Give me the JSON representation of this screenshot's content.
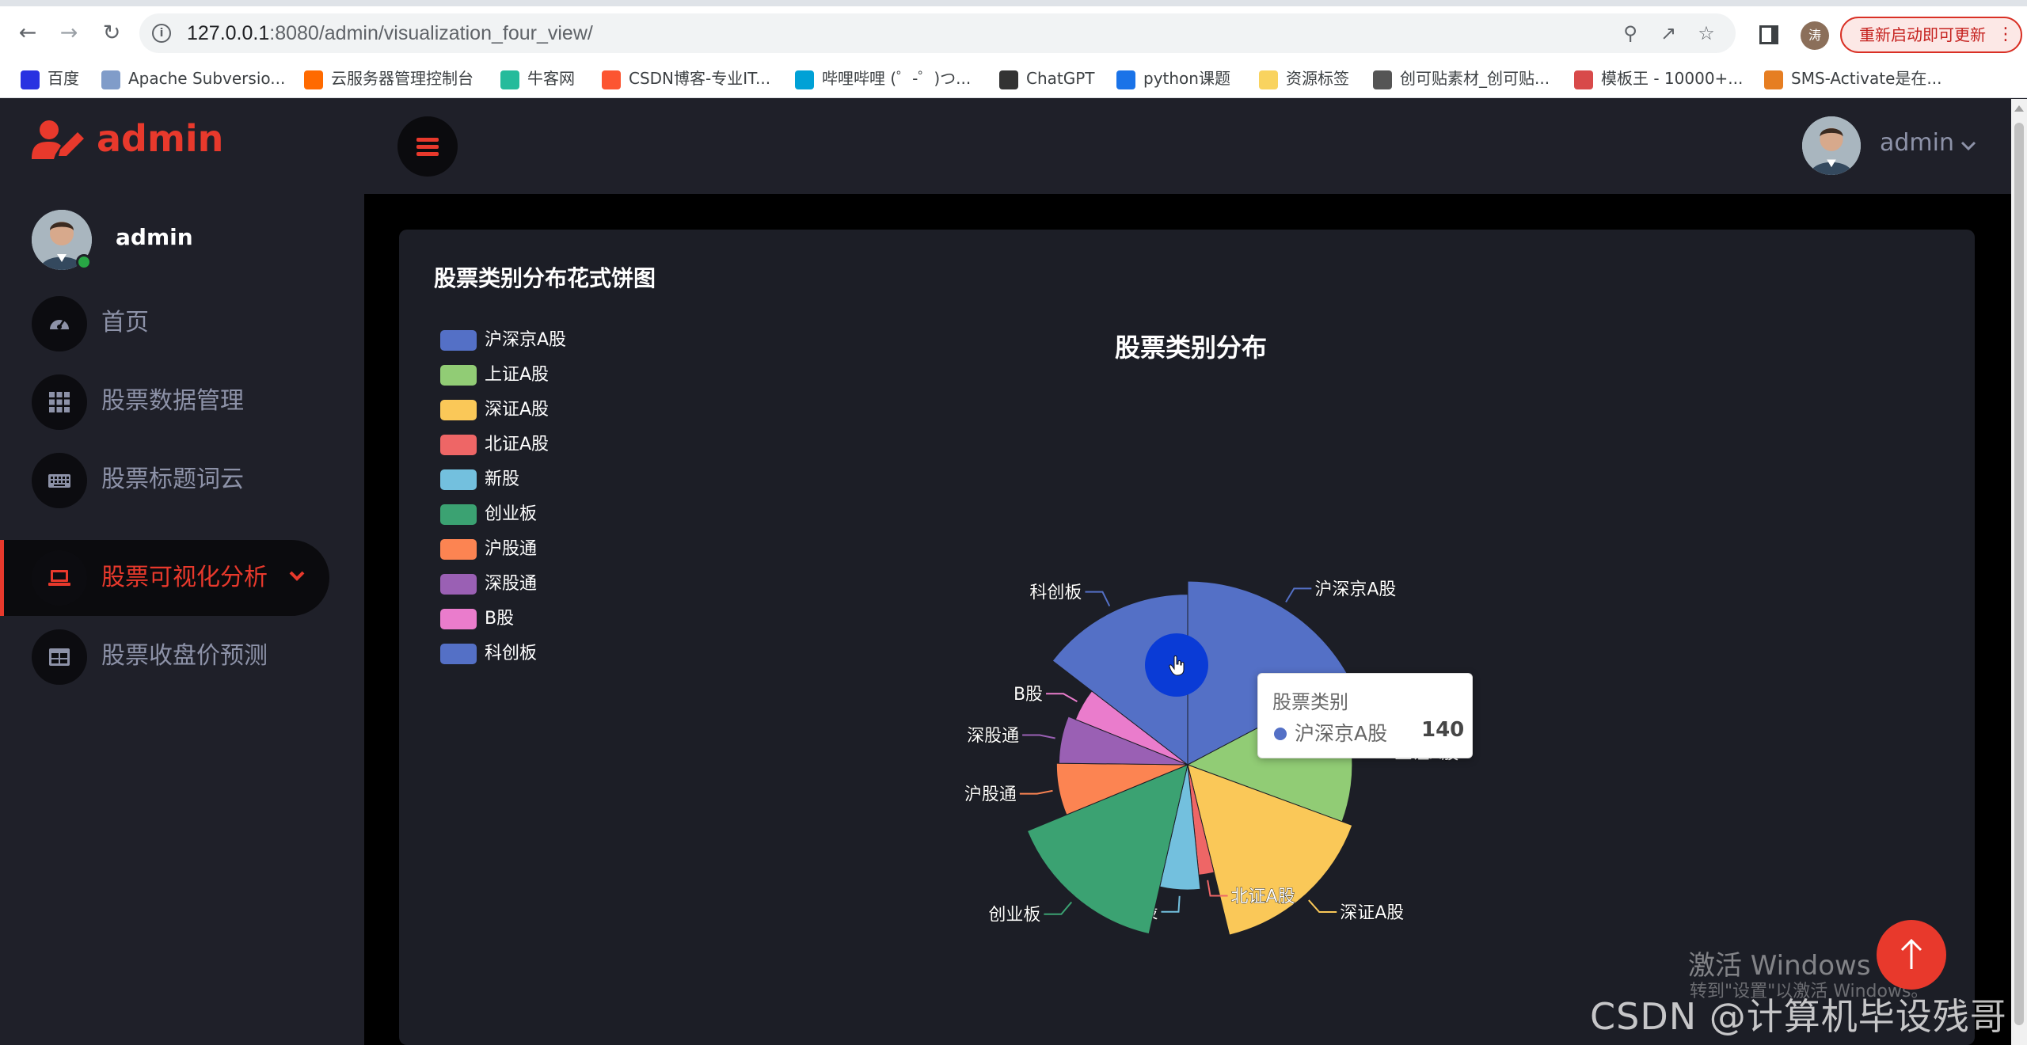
{
  "browser": {
    "url_host": "127.0.0.1",
    "url_rest": ":8080/admin/visualization_four_view/",
    "profile_initial": "涛",
    "update_label": "重新启动即可更新",
    "bookmarks": [
      {
        "label": "百度",
        "color": "#2932e1"
      },
      {
        "label": "Apache Subversio...",
        "color": "#809cc9"
      },
      {
        "label": "云服务器管理控制台",
        "color": "#ff6a00"
      },
      {
        "label": "牛客网",
        "color": "#25bb9b"
      },
      {
        "label": "CSDN博客-专业IT...",
        "color": "#fc5531"
      },
      {
        "label": "哔哩哔哩 (゜-゜)つ...",
        "color": "#00a1d6"
      },
      {
        "label": "ChatGPT",
        "color": "#333333"
      },
      {
        "label": "python课题",
        "color": "#1a73e8"
      },
      {
        "label": "资源标签",
        "color": "#f9d35f"
      },
      {
        "label": "创可贴素材_创可贴...",
        "color": "#555555"
      },
      {
        "label": "模板王 - 10000+...",
        "color": "#d84a4a"
      },
      {
        "label": "SMS-Activate是在...",
        "color": "#e67e22"
      }
    ]
  },
  "app": {
    "brand": "admin",
    "user_name": "admin",
    "top_user": "admin",
    "menu": [
      {
        "label": "首页",
        "icon": "dashboard-icon"
      },
      {
        "label": "股票数据管理",
        "icon": "grid-icon"
      },
      {
        "label": "股票标题词云",
        "icon": "keyboard-icon"
      },
      {
        "label": "股票可视化分析",
        "icon": "laptop-icon",
        "active": true
      },
      {
        "label": "股票收盘价预测",
        "icon": "table-icon"
      }
    ],
    "accent_color": "#e8392c"
  },
  "card": {
    "title": "股票类别分布花式饼图"
  },
  "chart_data": {
    "type": "pie",
    "title": "股票类别分布",
    "legend_position": "left",
    "categories": [
      "沪深京A股",
      "上证A股",
      "深证A股",
      "北证A股",
      "新股",
      "创业板",
      "沪股通",
      "深股通",
      "B股",
      "科创板"
    ],
    "values": [
      140,
      108,
      126,
      18,
      42,
      123,
      52,
      48,
      35,
      118
    ],
    "colors": [
      "#5470c6",
      "#91cc75",
      "#fac858",
      "#ee6666",
      "#73c0de",
      "#3ba272",
      "#fc8452",
      "#9a60b4",
      "#ea7ccc",
      "#5470c6"
    ],
    "radius_mode": "rose",
    "tooltip": {
      "title": "股票类别",
      "name": "沪深京A股",
      "value": "140"
    }
  },
  "overlay": {
    "windows_watermark": "激活 Windows",
    "windows_watermark_sub": "转到\"设置\"以激活 Windows。",
    "csdn_watermark": "CSDN @计算机毕设残哥"
  }
}
